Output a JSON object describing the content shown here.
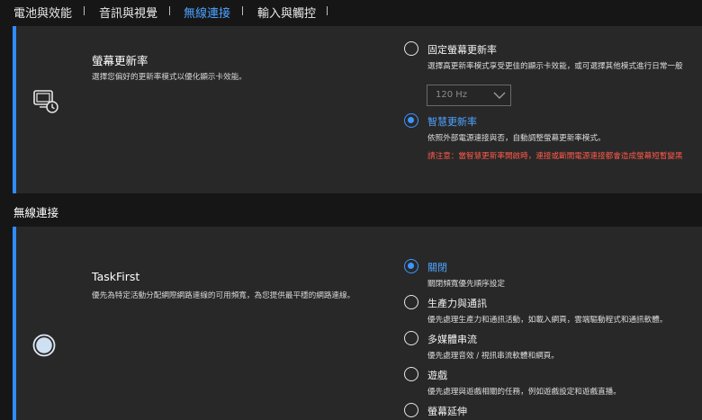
{
  "nav": {
    "tabs": [
      {
        "label": "電池與效能",
        "active": false
      },
      {
        "label": "音訊與視覺",
        "active": false
      },
      {
        "label": "無線連接",
        "active": true
      },
      {
        "label": "輸入與觸控",
        "active": false
      }
    ]
  },
  "refresh_panel": {
    "title": "螢幕更新率",
    "description": "選擇您偏好的更新率模式以優化顯示卡效能。",
    "icon": "display-refresh-icon",
    "options": [
      {
        "label": "固定螢幕更新率",
        "description": "選擇高更新率模式享受更佳的顯示卡效能，或可選擇其他模式進行日常一般",
        "checked": false
      },
      {
        "label": "智慧更新率",
        "description": "依照外部電源連接與否，自動調整螢幕更新率模式。",
        "warning": "請注意：當智慧更新率開啟時，連接或斷開電源連接都會造成螢幕短暫變黑",
        "checked": true
      }
    ],
    "dropdown": {
      "value": "120 Hz"
    }
  },
  "wireless_section": {
    "heading": "無線連接"
  },
  "taskfirst_panel": {
    "title": "TaskFirst",
    "description": "優先為特定活動分配網際網路連線的可用頻寬，為您提供最平穩的網路連線。",
    "icon": "globe-icon",
    "options": [
      {
        "label": "關閉",
        "description": "關閉頻寬優先順序設定",
        "checked": true
      },
      {
        "label": "生產力與通訊",
        "description": "優先處理生產力和通訊活動，如載入網頁，雲端驅動程式和通訊軟體。",
        "checked": false
      },
      {
        "label": "多媒體串流",
        "description": "優先處理音效 / 視訊串流軟體和網頁。",
        "checked": false
      },
      {
        "label": "遊戲",
        "description": "優先處理與遊戲相關的任務，例如遊戲設定和遊戲直播。",
        "checked": false
      },
      {
        "label": "螢幕延伸",
        "checked": false
      }
    ]
  },
  "colors": {
    "accent": "#2f8bff",
    "selected_text": "#4fa3ff",
    "warning": "#ff5a4a",
    "panel_bg": "#282828",
    "page_bg": "#161616"
  }
}
